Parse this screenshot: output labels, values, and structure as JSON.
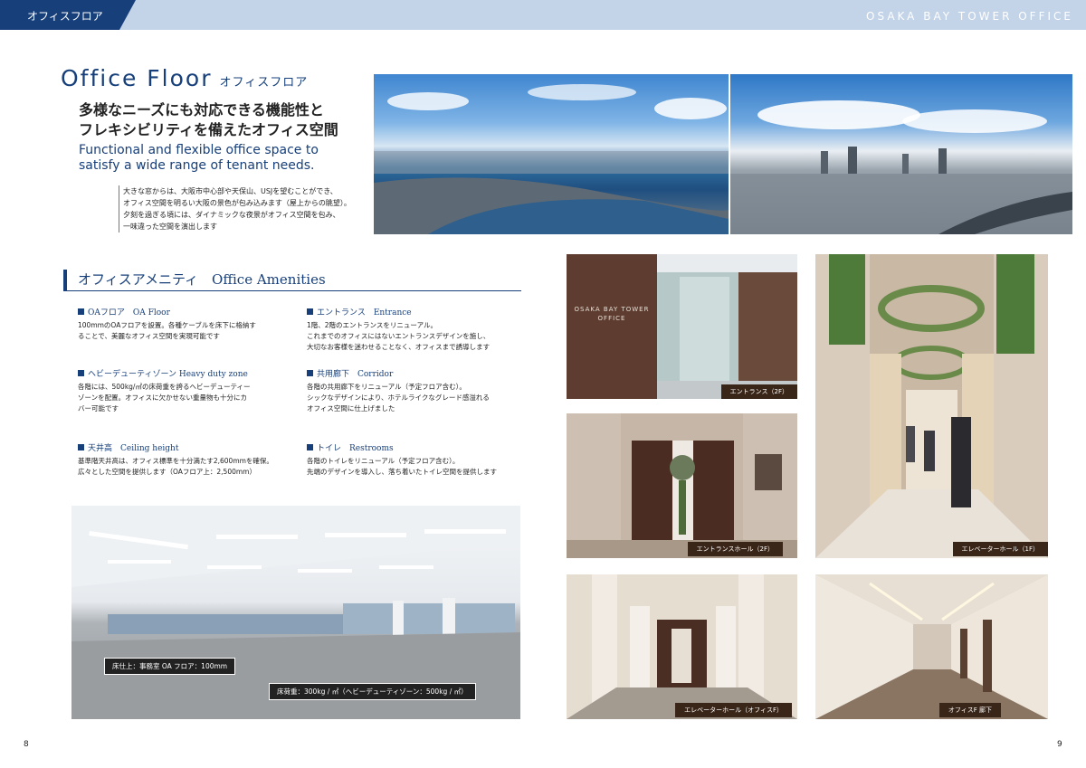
{
  "header": {
    "tab_label": "オフィスフロア",
    "brand": "OSAKA BAY TOWER OFFICE"
  },
  "title": {
    "main": "Office Floor",
    "sub": "オフィスフロア"
  },
  "heading": {
    "jp_line1": "多様なニーズにも対応できる機能性と",
    "jp_line2": "フレキシビリティを備えたオフィス空間",
    "en_line1": "Functional and flexible office space to",
    "en_line2": "satisfy a wide range of tenant needs."
  },
  "intro": [
    "大きな窓からは、大阪市中心部や天保山、USJを望むことができ、",
    "オフィス空間を明るい大阪の景色が包み込みます（屋上からの眺望）。",
    "夕刻を過ぎる頃には、ダイナミックな夜景がオフィス空間を包み、",
    "一味違った空間を演出します"
  ],
  "amenities": {
    "heading": "オフィスアメニティ　Office Amenities",
    "items": [
      {
        "title": "OAフロア　OA Floor",
        "body": [
          "100mmのOAフロアを設置。各種ケーブルを床下に格納す",
          "ることで、美麗なオフィス空間を実現可能です"
        ]
      },
      {
        "title": "エントランス　Entrance",
        "body": [
          "1階、2階のエントランスをリニューアル。",
          "これまでのオフィスにはないエントランスデザインを施し、",
          "大切なお客様を迷わせることなく、オフィスまで誘導します"
        ]
      },
      {
        "title": "ヘビーデューティゾーン  Heavy duty zone",
        "body": [
          "各階には、500kg/㎡の床荷重を誇るヘビーデューティー",
          "ゾーンを配置。オフィスに欠かせない重量物も十分にカ",
          "バー可能です"
        ]
      },
      {
        "title": "共用廊下　Corridor",
        "body": [
          "各階の共用廊下をリニューアル（予定フロア含む）。",
          "シックなデザインにより、ホテルライクなグレード感溢れる",
          "オフィス空間に仕上げました"
        ]
      },
      {
        "title": "天井高　Ceiling height",
        "body": [
          "基準階天井高は、オフィス標準を十分満たす2,600mmを確保。",
          "広々とした空間を提供します（OAフロア上：2,500mm）"
        ]
      },
      {
        "title": "トイレ　Restrooms",
        "body": [
          "各階のトイレをリニューアル（予定フロア含む）。",
          "先端のデザインを導入し、落ち着いたトイレ空間を提供します"
        ]
      }
    ]
  },
  "office_photo": {
    "spec1": "床仕上：事務室 OA フロア：100mm",
    "spec2": "床荷重：300kg / ㎡（ヘビーデューティゾーン：500kg / ㎡）"
  },
  "captions": {
    "entrance_2f": "エントランス（2F）",
    "entrance_hall_2f": "エントランスホール（2F）",
    "elevator_hall_1f": "エレベーターホール（1F）",
    "elevator_hall_office": "エレベーターホール（オフィスF）",
    "office_corridor": "オフィスF 廊下"
  },
  "entrance_sign": [
    "OSAKA BAY TOWER",
    "OFFICE"
  ],
  "pages": {
    "left": "8",
    "right": "9"
  }
}
